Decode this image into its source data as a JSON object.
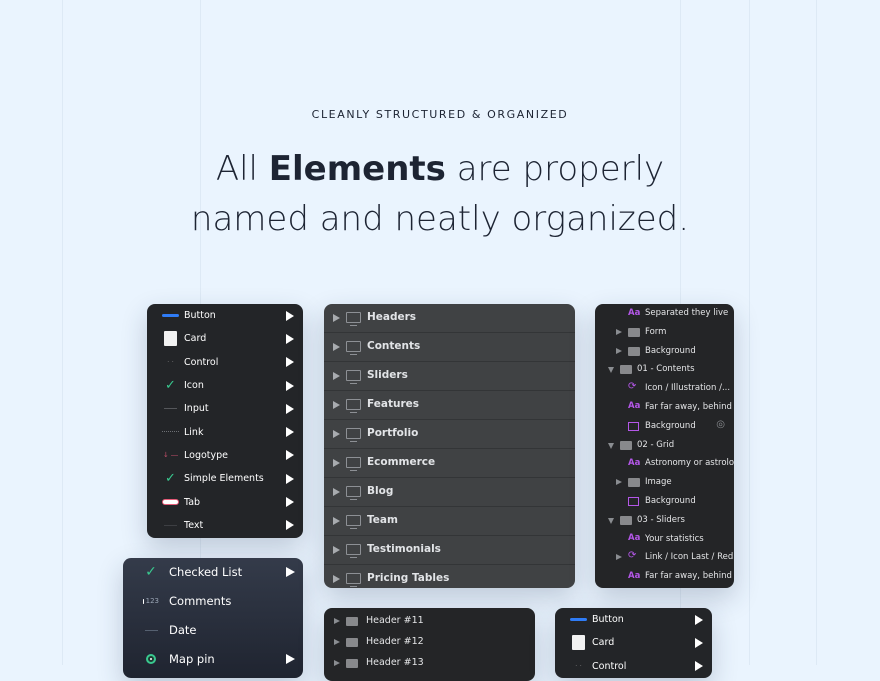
{
  "hero": {
    "eyebrow": "CLEANLY STRUCTURED & ORGANIZED",
    "title_prefix": "All ",
    "title_bold": "Elements",
    "title_suffix": " are properly",
    "title_line2": "named and neatly organized."
  },
  "symbols_menu": {
    "items": [
      {
        "label": "Button",
        "icon": "button-thumb"
      },
      {
        "label": "Card",
        "icon": "card-thumb"
      },
      {
        "label": "Control",
        "icon": "control-thumb"
      },
      {
        "label": "Icon",
        "icon": "checkmark-icon"
      },
      {
        "label": "Input",
        "icon": "input-thumb"
      },
      {
        "label": "Link",
        "icon": "link-thumb"
      },
      {
        "label": "Logotype",
        "icon": "logotype-thumb"
      },
      {
        "label": "Simple Elements",
        "icon": "checkmark-icon"
      },
      {
        "label": "Tab",
        "icon": "tab-thumb"
      },
      {
        "label": "Text",
        "icon": "text-thumb"
      }
    ]
  },
  "checked_menu": {
    "items": [
      {
        "label": "Checked List",
        "icon": "checkmark-icon",
        "text": ""
      },
      {
        "label": "Comments",
        "icon": "comment-icon",
        "text": "123"
      },
      {
        "label": "Date",
        "icon": "date-icon",
        "text": ""
      },
      {
        "label": "Map pin",
        "icon": "map-pin-icon",
        "text": ""
      }
    ]
  },
  "pages_panel": {
    "items": [
      "Headers",
      "Contents",
      "Sliders",
      "Features",
      "Portfolio",
      "Ecommerce",
      "Blog",
      "Team",
      "Testimonials",
      "Pricing Tables"
    ]
  },
  "layers_panel": {
    "rows": [
      {
        "label": "Separated they live",
        "icon": "text-layer-icon",
        "indent": 2,
        "toggle": "none"
      },
      {
        "label": "Form",
        "icon": "folder-icon",
        "indent": 1,
        "toggle": "collapsed"
      },
      {
        "label": "Background",
        "icon": "folder-icon",
        "indent": 1,
        "toggle": "collapsed"
      },
      {
        "label": "01 - Contents",
        "icon": "folder-icon",
        "indent": 0,
        "toggle": "expanded"
      },
      {
        "label": "Icon / Illustration /...",
        "icon": "symbol-icon",
        "indent": 1,
        "toggle": "none"
      },
      {
        "label": "Far far away, behind",
        "icon": "text-layer-icon",
        "indent": 1,
        "toggle": "none"
      },
      {
        "label": "Background",
        "icon": "image-layer-icon",
        "indent": 1,
        "toggle": "none",
        "hidden": true
      },
      {
        "label": "02 - Grid",
        "icon": "folder-icon",
        "indent": 0,
        "toggle": "expanded"
      },
      {
        "label": "Astronomy or astrolo",
        "icon": "text-layer-icon",
        "indent": 1,
        "toggle": "none"
      },
      {
        "label": "Image",
        "icon": "folder-icon",
        "indent": 1,
        "toggle": "collapsed"
      },
      {
        "label": "Background",
        "icon": "image-layer-icon",
        "indent": 1,
        "toggle": "none"
      },
      {
        "label": "03 - Sliders",
        "icon": "folder-icon",
        "indent": 0,
        "toggle": "expanded"
      },
      {
        "label": "Your statistics",
        "icon": "text-layer-icon",
        "indent": 1,
        "toggle": "none"
      },
      {
        "label": "Link / Icon Last / Red",
        "icon": "symbol-icon",
        "indent": 1,
        "toggle": "collapsed"
      },
      {
        "label": "Far far away, behind",
        "icon": "text-layer-icon",
        "indent": 1,
        "toggle": "none"
      }
    ]
  },
  "header_folders": {
    "items": [
      "Header #11",
      "Header #12",
      "Header #13"
    ]
  },
  "symbols_menu_small": {
    "items": [
      {
        "label": "Button",
        "icon": "button-thumb"
      },
      {
        "label": "Card",
        "icon": "card-thumb"
      },
      {
        "label": "Control",
        "icon": "control-thumb"
      }
    ]
  },
  "colors": {
    "background": "#eaf4fe",
    "accent_blue": "#2f7cf6",
    "accent_green": "#39c98f",
    "layer_purple": "#b457e8",
    "panel_dark": "#232528",
    "panel_gray": "#404244"
  }
}
